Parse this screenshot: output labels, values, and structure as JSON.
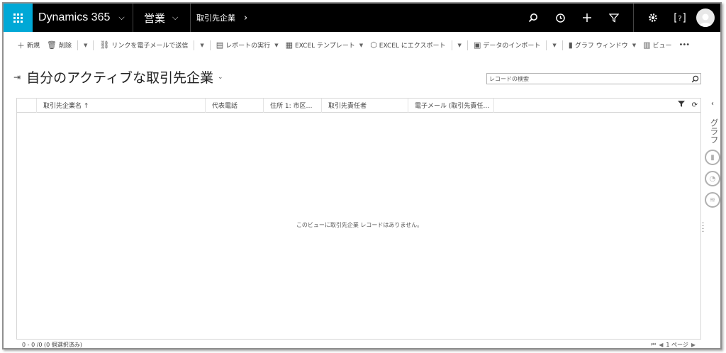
{
  "nav": {
    "app_name": "Dynamics 365",
    "module": "営業",
    "breadcrumb": "取引先企業",
    "icons": [
      "search-icon",
      "history-icon",
      "plus-icon",
      "filter-icon",
      "gear-icon",
      "help-icon",
      "user-avatar"
    ]
  },
  "toolbar": {
    "new": "新規",
    "delete": "削除",
    "email_link": "リンクを電子メールで送信",
    "run_report": "レポートの実行",
    "excel_template": "EXCEL テンプレート",
    "export_excel": "EXCEL にエクスポート",
    "import_data": "データのインポート",
    "chart_pane": "グラフ ウィンドウ",
    "view": "ビュー",
    "more": "•••"
  },
  "page": {
    "title": "自分のアクティブな取引先企業",
    "search_placeholder": "レコードの検索"
  },
  "grid": {
    "columns": [
      "取引先企業名 ↑",
      "代表電話",
      "住所 1: 市区…",
      "取引先責任者",
      "電子メール (取引先責任…"
    ],
    "empty_message": "このビューに取引先企業 レコードはありません。",
    "status": "0 - 0 /0 (0 個選択済み)",
    "page_label": "1 ページ"
  },
  "chart_rail": {
    "label": "グラフ"
  },
  "colors": {
    "accent": "#00a8d6",
    "navbar": "#000000"
  }
}
